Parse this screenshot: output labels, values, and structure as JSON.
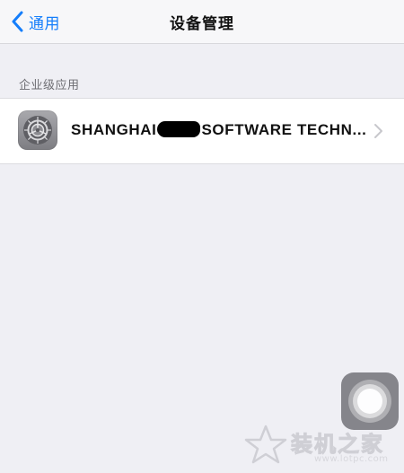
{
  "navbar": {
    "back_label": "通用",
    "title": "设备管理"
  },
  "section": {
    "header": "企业级应用"
  },
  "profile": {
    "name_prefix": "SHANGHAI",
    "name_suffix": "SOFTWARE TECHN...",
    "icon": "settings-gear-icon"
  },
  "watermark": {
    "brand": "装机之家",
    "url": "www.lotpc.com"
  },
  "colors": {
    "accent": "#157efb",
    "background": "#efeff4",
    "cell": "#ffffff"
  }
}
